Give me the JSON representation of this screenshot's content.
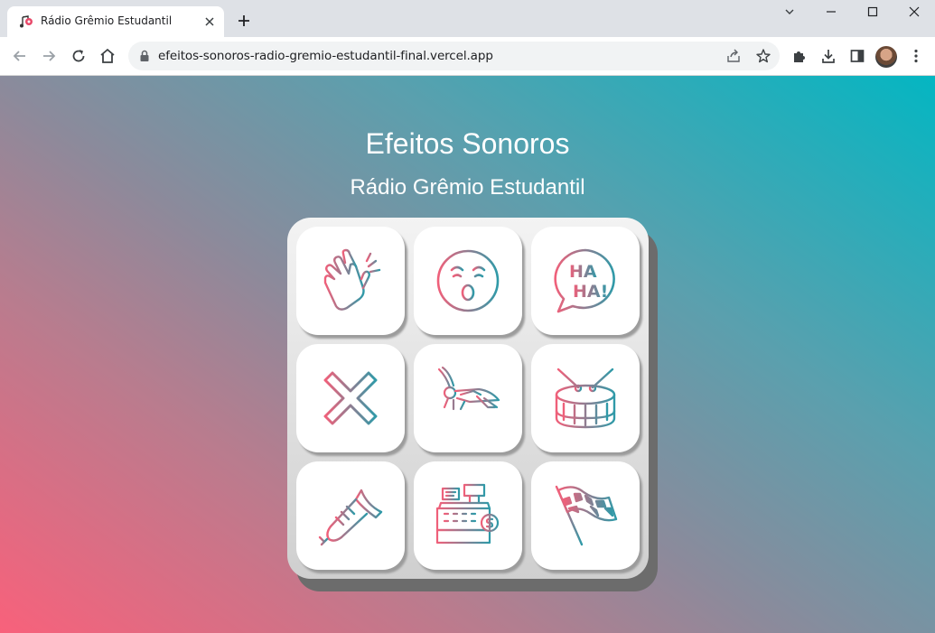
{
  "browser": {
    "tab_title": "Rádio Grêmio Estudantil",
    "url": "efeitos-sonoros-radio-gremio-estudantil-final.vercel.app"
  },
  "page": {
    "title": "Efeitos Sonoros",
    "subtitle": "Rádio Grêmio Estudantil"
  },
  "colors": {
    "icon_start": "#f0607a",
    "icon_end": "#2f9aa8"
  },
  "pads": [
    {
      "icon": "applause-icon"
    },
    {
      "icon": "surprised-face-icon"
    },
    {
      "icon": "haha-speech-bubble-icon"
    },
    {
      "icon": "x-mark-icon"
    },
    {
      "icon": "cricket-icon"
    },
    {
      "icon": "drum-icon"
    },
    {
      "icon": "trumpet-icon"
    },
    {
      "icon": "cash-register-icon"
    },
    {
      "icon": "checkered-flag-icon"
    }
  ],
  "haha_text": {
    "line1": "HA",
    "line2": "HA!"
  }
}
